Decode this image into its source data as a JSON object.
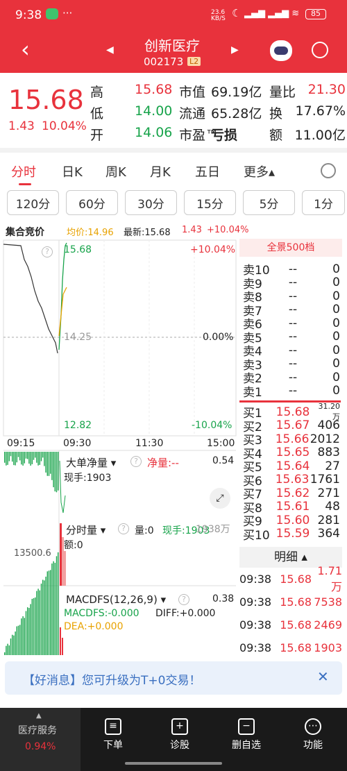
{
  "status": {
    "time": "9:38",
    "net": "23.6 KB/S",
    "battery": "85"
  },
  "header": {
    "name": "创新医疗",
    "code": "002173",
    "level": "L2"
  },
  "quote": {
    "price": "15.68",
    "change": "1.43",
    "pct": "10.04%",
    "rows": [
      {
        "k1": "高",
        "v1": "15.68",
        "k2": "市值",
        "v2": "69.19亿",
        "k3": "量比",
        "v3": "21.30"
      },
      {
        "k1": "低",
        "v1": "14.00",
        "k2": "流通",
        "v2": "65.28亿",
        "k3": "换",
        "v3": "17.67%"
      },
      {
        "k1": "开",
        "v1": "14.06",
        "k2": "市盈™",
        "v2": "亏损",
        "k3": "额",
        "v3": "11.00亿"
      }
    ]
  },
  "tabs": [
    "分时",
    "日K",
    "周K",
    "月K",
    "五日",
    "更多▴"
  ],
  "periods": [
    "120分",
    "60分",
    "30分",
    "15分",
    "5分",
    "1分"
  ],
  "chart": {
    "title": "集合竞价",
    "avg": "均价:14.96",
    "latest": "最新:15.68",
    "chg": "1.43",
    "pct": "+10.04%",
    "high": "15.68",
    "mid": "14.25",
    "low": "12.82",
    "pct_hi": "+10.04%",
    "pct_mid": "0.00%",
    "pct_lo": "-10.04%",
    "t1": "09:15",
    "t2": "09:30",
    "t3": "11:30",
    "t4": "15:00",
    "vol_label": "13500.6"
  },
  "ind1": {
    "name": "大单净量",
    "label": "净量:--",
    "value": "0.54",
    "hand": "现手:1903"
  },
  "ind2": {
    "name": "分时量",
    "qty": "量:0",
    "hand": "现手:1903",
    "right": "1938万",
    "amount": "额:0"
  },
  "ind3": {
    "name": "MACDFS(12,26,9)",
    "value": "0.38",
    "macd": "MACDFS:-0.000",
    "diff": "DIFF:+0.000",
    "dea": "DEA:+0.000"
  },
  "orderbook": {
    "title": "全景500档",
    "asks": [
      {
        "l": "卖10",
        "p": "--",
        "v": "0"
      },
      {
        "l": "卖9",
        "p": "--",
        "v": "0"
      },
      {
        "l": "卖8",
        "p": "--",
        "v": "0"
      },
      {
        "l": "卖7",
        "p": "--",
        "v": "0"
      },
      {
        "l": "卖6",
        "p": "--",
        "v": "0"
      },
      {
        "l": "卖5",
        "p": "--",
        "v": "0"
      },
      {
        "l": "卖4",
        "p": "--",
        "v": "0"
      },
      {
        "l": "卖3",
        "p": "--",
        "v": "0"
      },
      {
        "l": "卖2",
        "p": "--",
        "v": "0"
      },
      {
        "l": "卖1",
        "p": "--",
        "v": "0"
      }
    ],
    "bids": [
      {
        "l": "买1",
        "p": "15.68",
        "v": "31.20万"
      },
      {
        "l": "买2",
        "p": "15.67",
        "v": "406"
      },
      {
        "l": "买3",
        "p": "15.66",
        "v": "2012"
      },
      {
        "l": "买4",
        "p": "15.65",
        "v": "883"
      },
      {
        "l": "买5",
        "p": "15.64",
        "v": "27"
      },
      {
        "l": "买6",
        "p": "15.63",
        "v": "1761"
      },
      {
        "l": "买7",
        "p": "15.62",
        "v": "271"
      },
      {
        "l": "买8",
        "p": "15.61",
        "v": "48"
      },
      {
        "l": "买9",
        "p": "15.60",
        "v": "281"
      },
      {
        "l": "买10",
        "p": "15.59",
        "v": "364"
      }
    ]
  },
  "ticks": {
    "title": "明细 ▴",
    "rows": [
      {
        "t": "09:38",
        "p": "15.68",
        "v": "1.71万"
      },
      {
        "t": "09:38",
        "p": "15.68",
        "v": "7538"
      },
      {
        "t": "09:38",
        "p": "15.68",
        "v": "2469"
      },
      {
        "t": "09:38",
        "p": "15.68",
        "v": "1903"
      }
    ]
  },
  "banner": "【好消息】您可升级为T+0交易！",
  "bottom": {
    "sector": "医疗服务",
    "sector_pct": "0.94%",
    "items": [
      "下单",
      "诊股",
      "删自选",
      "功能"
    ]
  }
}
